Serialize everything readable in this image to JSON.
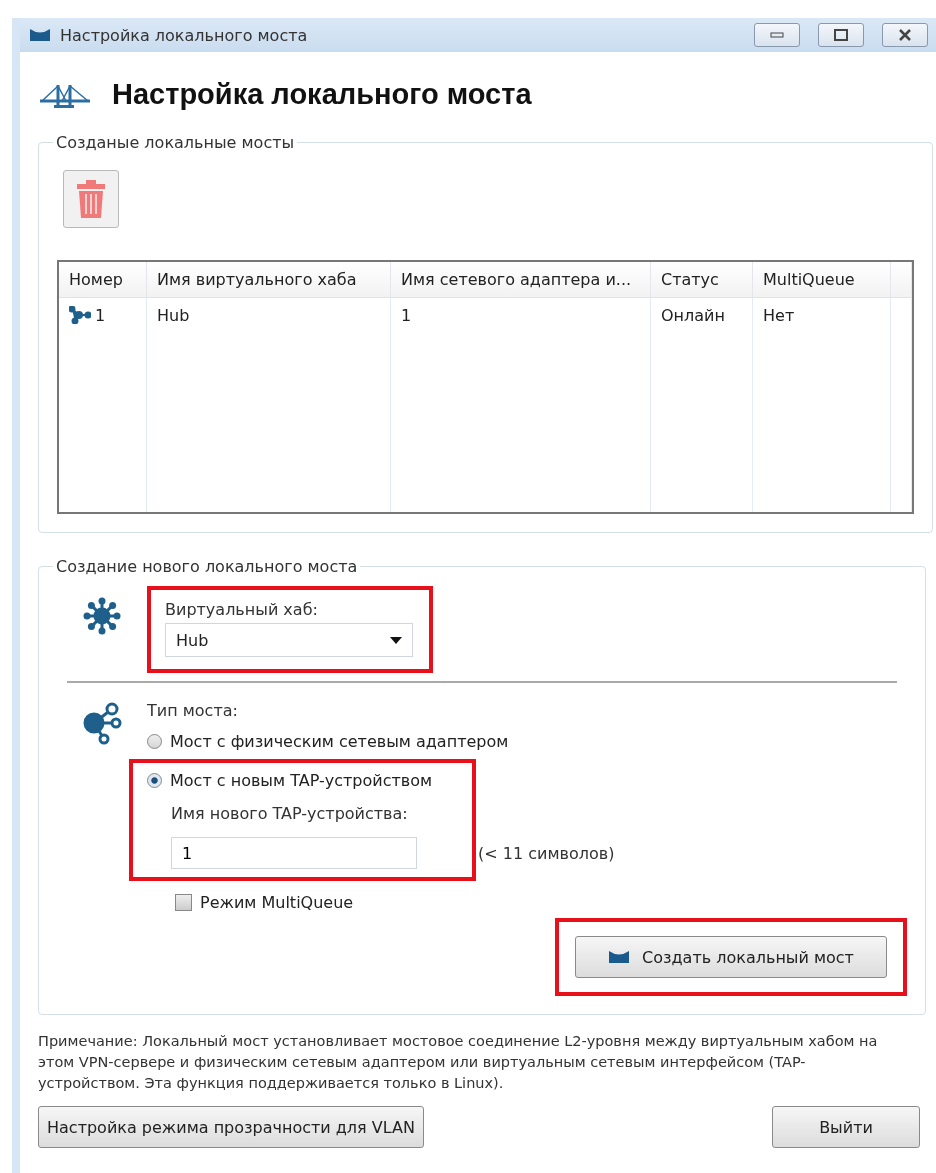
{
  "window": {
    "title": "Настройка локального моста"
  },
  "heading": "Настройка локального моста",
  "existing": {
    "legend": "Созданые локальные мосты"
  },
  "table": {
    "columns": [
      "Номер",
      "Имя виртуального хаба",
      "Имя сетевого адаптера и...",
      "Статус",
      "MultiQueue"
    ],
    "rows": [
      {
        "cells": [
          "1",
          "Hub",
          "1",
          "Онлайн",
          "Нет"
        ]
      }
    ]
  },
  "create": {
    "legend": "Создание нового локального моста",
    "hub_label": "Виртуальный хаб:",
    "hub_select": {
      "value": "Hub"
    },
    "type_label": "Тип моста:",
    "options": [
      {
        "label": "Мост с физическим сетевым адаптером",
        "selected": false
      },
      {
        "label": "Мост с новым TAP-устройством",
        "selected": true
      }
    ],
    "tap_label": "Имя нового TAP-устройства:",
    "tap_name": {
      "value": "1"
    },
    "tap_hint": "(< 11 символов)",
    "multiqueue": {
      "label": "Режим MultiQueue",
      "checked": false
    },
    "create_button": "Создать локальный мост"
  },
  "note": "Примечание: Локальный мост установливает мостовое соединение L2-уровня между виртуальным хабом на этом VPN-сервере и физическим сетевым адаптером или виртуальным сетевым интерфейсом (TAP-устройством. Эта функция поддерживается только в Linux).",
  "buttons": {
    "vlan": "Настройка режима прозрачности для VLAN",
    "exit": "Выйти"
  }
}
